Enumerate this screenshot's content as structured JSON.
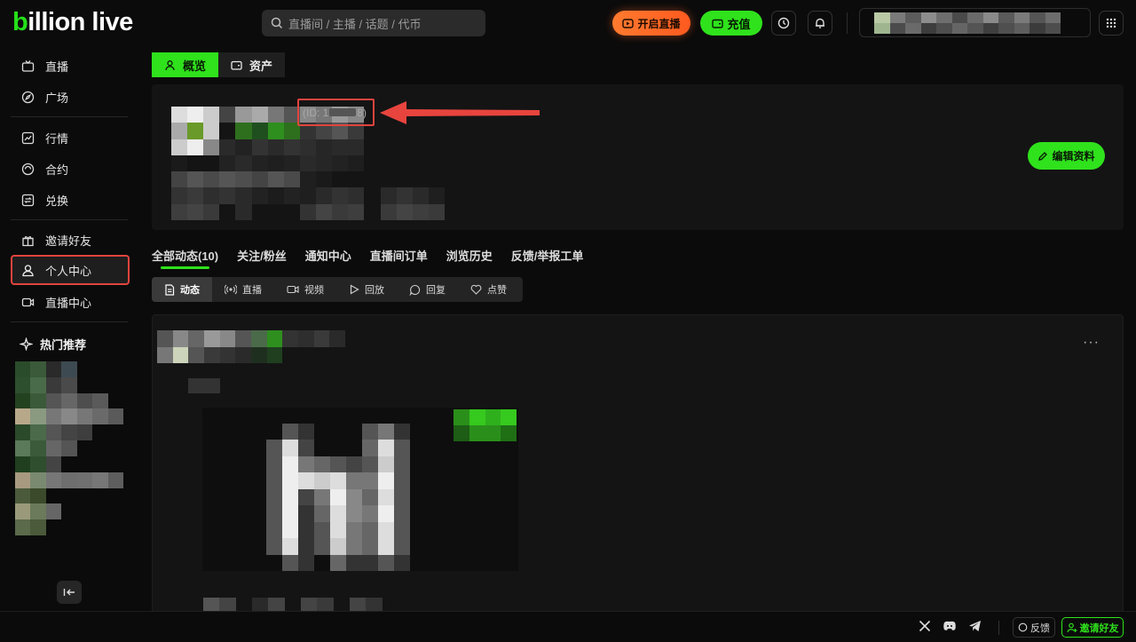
{
  "brand": {
    "logo_b": "b",
    "logo_rest": "illion live",
    "accent": "#2fe21c"
  },
  "header": {
    "search_placeholder": "直播间 / 主播 / 话题 / 代币",
    "live_button": "开启直播",
    "charge_button": "充值"
  },
  "sidebar": {
    "items": [
      {
        "label": "直播",
        "icon": "tv-icon"
      },
      {
        "label": "广场",
        "icon": "compass-icon"
      },
      {
        "label": "行情",
        "icon": "chart-icon"
      },
      {
        "label": "合约",
        "icon": "contract-icon"
      },
      {
        "label": "兑换",
        "icon": "swap-icon"
      },
      {
        "label": "邀请好友",
        "icon": "gift-icon"
      },
      {
        "label": "个人中心",
        "icon": "user-icon"
      },
      {
        "label": "直播中心",
        "icon": "camera-icon"
      }
    ],
    "hot_title": "热门推荐",
    "active": "个人中心"
  },
  "main_tabs": {
    "overview": "概览",
    "assets": "资产"
  },
  "profile": {
    "id_prefix": "(ID: 1",
    "id_suffix": "8)",
    "edit_button": "编辑资料"
  },
  "sub_tabs": [
    "全部动态(10)",
    "关注/粉丝",
    "通知中心",
    "直播间订单",
    "浏览历史",
    "反馈/举报工单"
  ],
  "filters": [
    "动态",
    "直播",
    "视频",
    "回放",
    "回复",
    "点赞"
  ],
  "post": {
    "more": "···"
  },
  "footer": {
    "feedback": "反馈",
    "invite": "邀请好友"
  },
  "colors": {
    "annotation": "#e0443e",
    "live_button": "#ff6a25"
  }
}
